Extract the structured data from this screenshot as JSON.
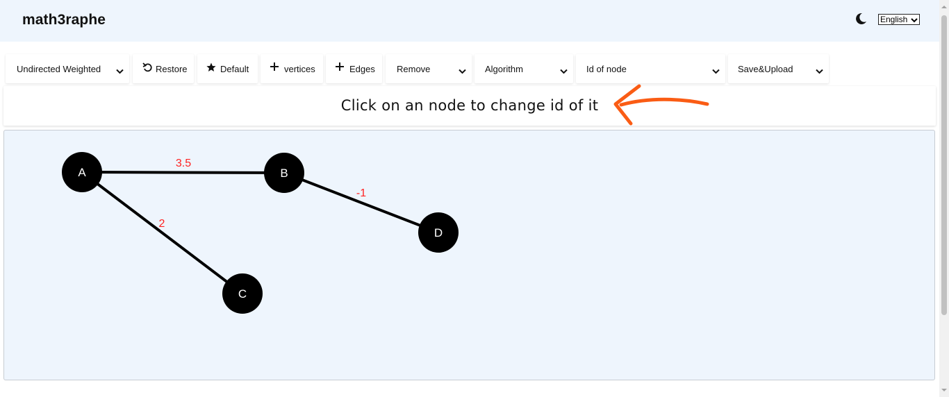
{
  "app": {
    "title": "math3raphe"
  },
  "header": {
    "language": "English"
  },
  "toolbar": {
    "graph_type": "Undirected Weighted",
    "restore": "Restore",
    "default": "Default",
    "vertices": "vertices",
    "edges": "Edges",
    "remove": "Remove",
    "algorithm": "Algorithm",
    "id_of_node": "Id of node",
    "save_upload": "Save&Upload"
  },
  "notice": {
    "text": "Click on an node to change id of it"
  },
  "colors": {
    "header_bg": "#eef5fd",
    "canvas_bg": "#eef5fd",
    "node": "#000000",
    "edge_weight": "#ff2222",
    "arrow": "#fa5c14"
  },
  "graph": {
    "nodes": [
      {
        "id": "A"
      },
      {
        "id": "B"
      },
      {
        "id": "C"
      },
      {
        "id": "D"
      }
    ],
    "edges": [
      {
        "from": "A",
        "to": "B",
        "weight": "3.5"
      },
      {
        "from": "A",
        "to": "C",
        "weight": "2"
      },
      {
        "from": "B",
        "to": "D",
        "weight": "-1"
      }
    ]
  }
}
